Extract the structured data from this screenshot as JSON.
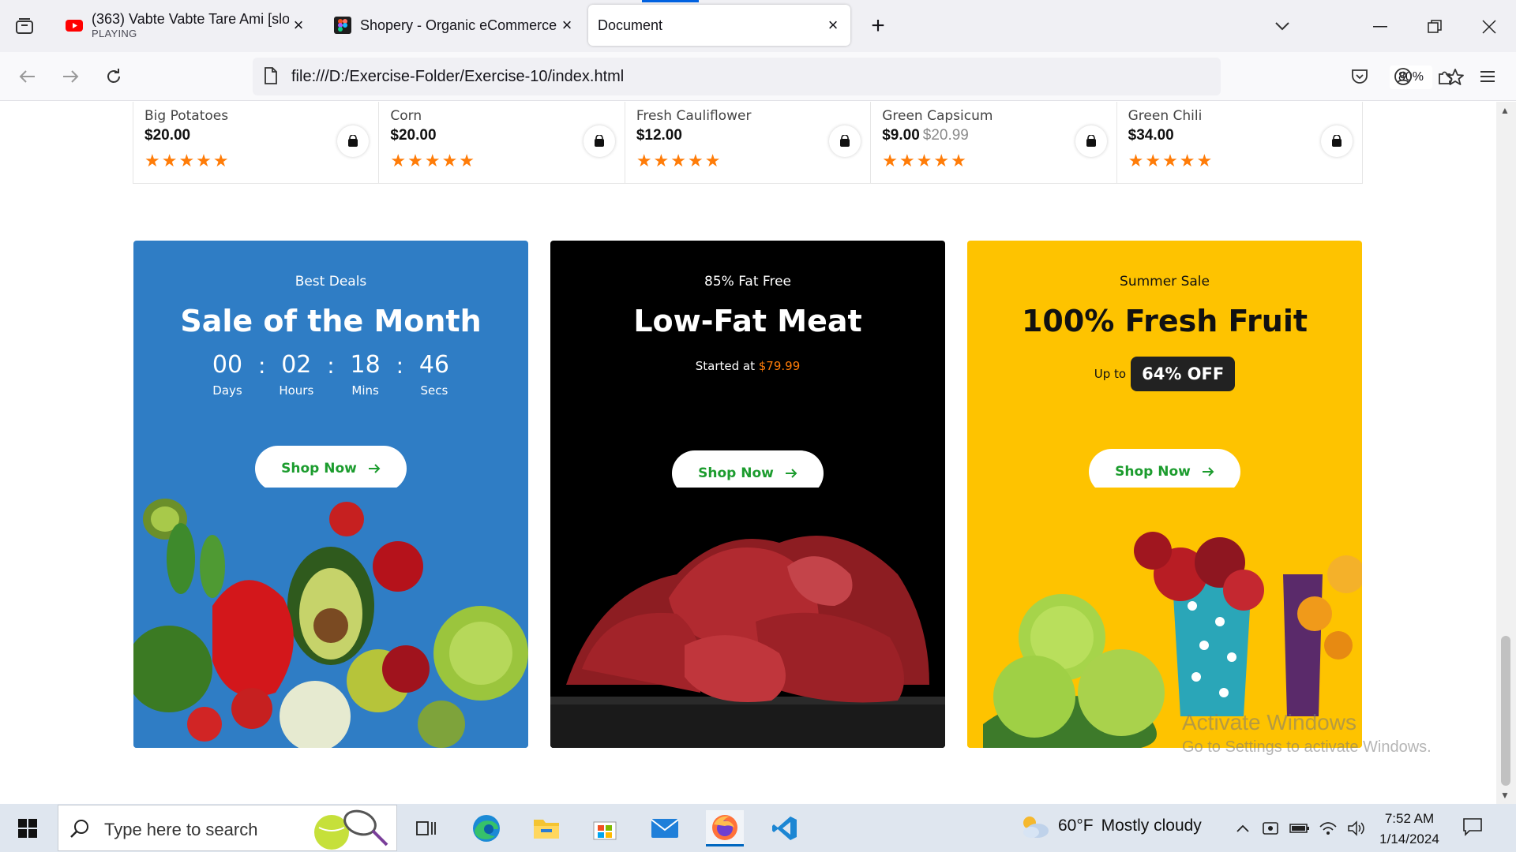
{
  "browser": {
    "tabs": [
      {
        "title": "(363) Vabte Vabte Tare Ami [slo",
        "subtitle": "PLAYING",
        "favicon": "youtube-icon"
      },
      {
        "title": "Shopery - Organic eCommerce",
        "favicon": "figma-icon"
      },
      {
        "title": "Document",
        "active": true
      }
    ],
    "url": "file:///D:/Exercise-Folder/Exercise-10/index.html",
    "zoom": "80%"
  },
  "products": [
    {
      "name": "Big Potatoes",
      "price": "$20.00",
      "old_price": "",
      "rating": 5
    },
    {
      "name": "Corn",
      "price": "$20.00",
      "old_price": "",
      "rating": 5
    },
    {
      "name": "Fresh Cauliflower",
      "price": "$12.00",
      "old_price": "",
      "rating": 5
    },
    {
      "name": "Green Capsicum",
      "price": "$9.00",
      "old_price": "$20.99",
      "rating": 5
    },
    {
      "name": "Green Chili",
      "price": "$34.00",
      "old_price": "",
      "rating": 5
    }
  ],
  "banners": {
    "deals": {
      "kicker": "Best Deals",
      "title": "Sale of the Month",
      "countdown": [
        {
          "value": "00",
          "label": "Days"
        },
        {
          "value": "02",
          "label": "Hours"
        },
        {
          "value": "18",
          "label": "Mins"
        },
        {
          "value": "46",
          "label": "Secs"
        }
      ],
      "separator": ":",
      "button": "Shop Now",
      "bg": "#2f7dc5"
    },
    "meat": {
      "kicker": "85% Fat Free",
      "title": "Low-Fat Meat",
      "started_prefix": "Started at",
      "started_price": "$79.99",
      "button": "Shop Now",
      "bg": "#000000"
    },
    "fruit": {
      "kicker": "Summer Sale",
      "title": "100% Fresh Fruit",
      "upto": "Up to",
      "discount": "64% OFF",
      "button": "Shop Now",
      "bg": "#fec300"
    }
  },
  "watermark": {
    "line1": "Activate Windows",
    "line2": "Go to Settings to activate Windows."
  },
  "taskbar": {
    "search_placeholder": "Type here to search",
    "weather_temp": "60°F",
    "weather_text": "Mostly cloudy",
    "time": "7:52 AM",
    "date": "1/14/2024"
  },
  "colors": {
    "accent": "#1c9c2e",
    "star": "#ff7c08",
    "highlight": "#ff7c08"
  }
}
